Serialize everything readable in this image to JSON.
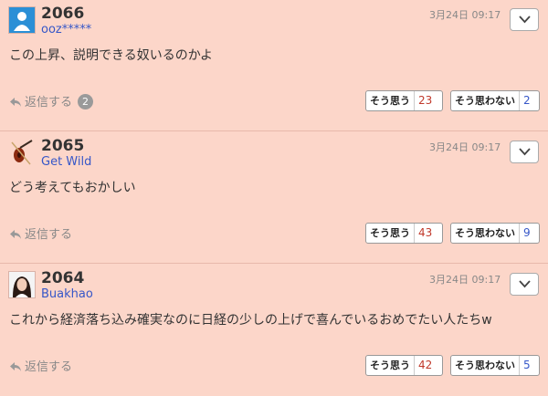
{
  "comments": [
    {
      "number": "2066",
      "username": "ooz*****",
      "date": "3月24日 09:17",
      "text": "この上昇、説明できる奴いるのかよ",
      "reply_label": "返信する",
      "reply_count": "2",
      "agree_label": "そう思う",
      "agree_count": "23",
      "disagree_label": "そう思わない",
      "disagree_count": "2"
    },
    {
      "number": "2065",
      "username": "Get Wild",
      "date": "3月24日 09:17",
      "text": "どう考えてもおかしい",
      "reply_label": "返信する",
      "agree_label": "そう思う",
      "agree_count": "43",
      "disagree_label": "そう思わない",
      "disagree_count": "9"
    },
    {
      "number": "2064",
      "username": "Buakhao",
      "date": "3月24日 09:17",
      "text": "これから経済落ち込み確実なのに日経の少しの上げで喜んでいるおめでたい人たちw",
      "reply_label": "返信する",
      "agree_label": "そう思う",
      "agree_count": "42",
      "disagree_label": "そう思わない",
      "disagree_count": "5"
    }
  ]
}
